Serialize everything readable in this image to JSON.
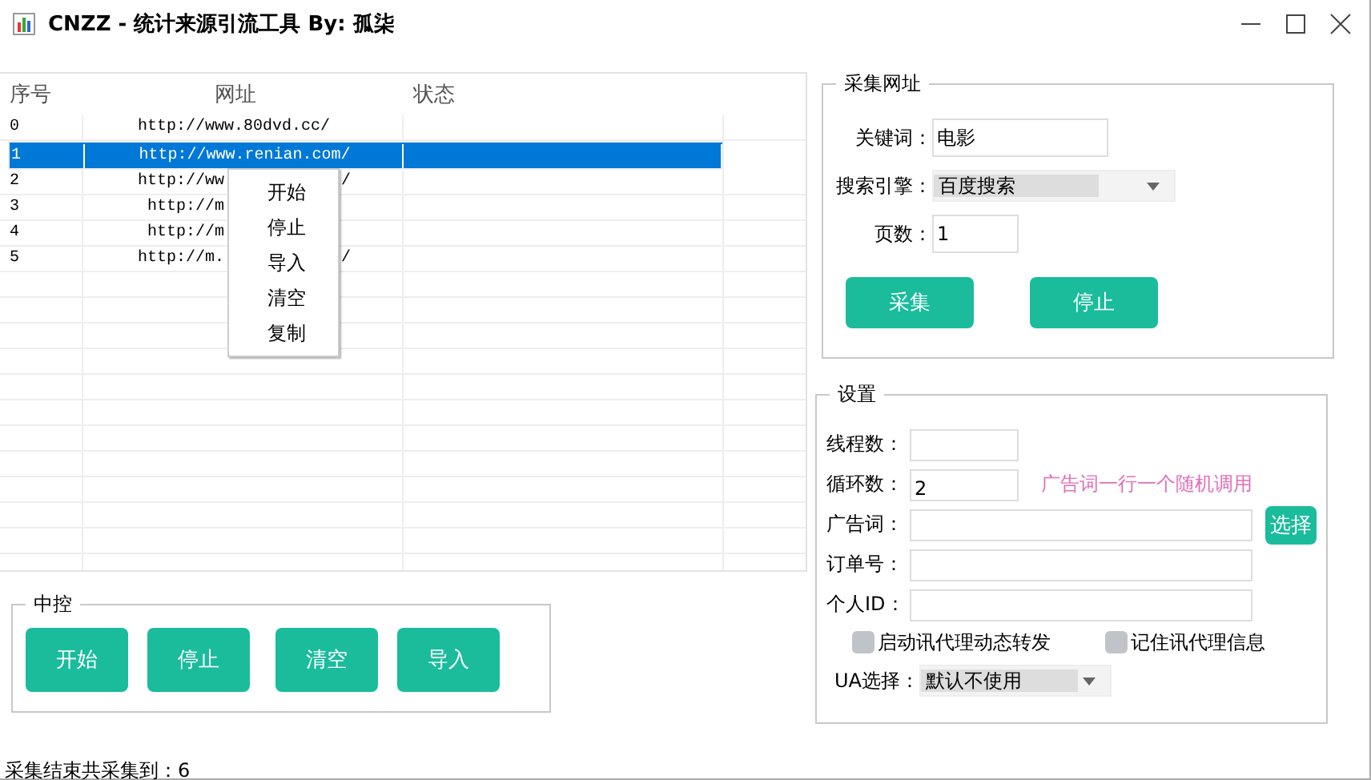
{
  "window": {
    "title": "CNZZ - 统计来源引流工具 By: 孤柒"
  },
  "table": {
    "columns": [
      "序号",
      "网址",
      "状态"
    ],
    "rows": [
      {
        "index": "0",
        "url": "http://www.80dvd.cc/",
        "selected": false
      },
      {
        "index": "1",
        "url": "http://www.renian.com/",
        "selected": true
      },
      {
        "index": "2",
        "url": "http://ww",
        "url_tail": "/",
        "selected": false
      },
      {
        "index": "3",
        "url": "http://m",
        "selected": false
      },
      {
        "index": "4",
        "url": "http://m",
        "selected": false
      },
      {
        "index": "5",
        "url": "http://m.",
        "url_tail": "/",
        "selected": false
      }
    ]
  },
  "context_menu": {
    "items": [
      "开始",
      "停止",
      "导入",
      "清空",
      "复制"
    ]
  },
  "control_group": {
    "title": "中控",
    "buttons": [
      "开始",
      "停止",
      "清空",
      "导入"
    ]
  },
  "collect_group": {
    "title": "采集网址",
    "fields": [
      {
        "kind": "input",
        "label": "关键词：",
        "value": "电影"
      },
      {
        "kind": "select",
        "label": "搜索引擎：",
        "value": "百度搜索"
      },
      {
        "kind": "input",
        "label": "页数：",
        "value": "1"
      }
    ],
    "buttons": [
      "采集",
      "停止"
    ]
  },
  "settings_group": {
    "title": "设置",
    "fields": [
      {
        "kind": "short",
        "label": "线程数："
      },
      {
        "kind": "short",
        "label": "循环数：",
        "value": "2",
        "hint": "广告词一行一个随机调用"
      },
      {
        "kind": "wide",
        "label": "广告词：",
        "button": "选择"
      },
      {
        "kind": "wide",
        "label": "订单号："
      },
      {
        "kind": "wide",
        "label": "个人ID："
      }
    ],
    "checkboxes": [
      {
        "label": "启动讯代理动态转发",
        "checked": false
      },
      {
        "label": "记住讯代理信息",
        "checked": false
      }
    ],
    "ua_select": {
      "label": "UA选择：",
      "value": "默认不使用"
    }
  },
  "status_bar": "采集结束共采集到：6"
}
